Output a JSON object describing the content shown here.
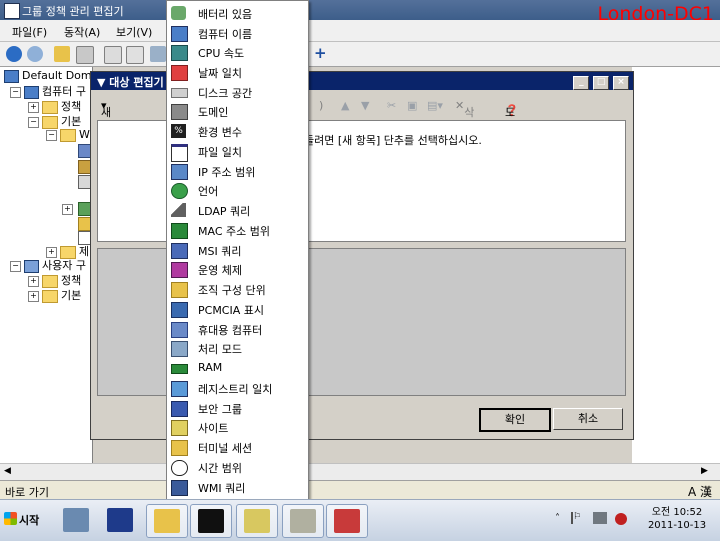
{
  "window": {
    "title": "그룹 정책 관리 편집기",
    "watermark": "London-DC1"
  },
  "menubar": {
    "items": [
      "파일(F)",
      "동작(A)",
      "보기(V)"
    ]
  },
  "tree": {
    "nodes": [
      {
        "label": "Default Dom"
      },
      {
        "label": "컴퓨터 구"
      },
      {
        "label": "정책"
      },
      {
        "label": "기본"
      },
      {
        "label": "W"
      },
      {
        "label": "제"
      },
      {
        "label": "사용자 구"
      },
      {
        "label": "정책"
      },
      {
        "label": "기본"
      }
    ]
  },
  "dialog": {
    "title": "대상 편집기",
    "new_item": "새 항목(N)",
    "delete": "삭제",
    "help": "도움말(H)",
    "hint_text": "들려면 [새 항목] 단추를 선택하십시오.",
    "ok": "확인",
    "cancel": "취소"
  },
  "menu": {
    "items": [
      {
        "label": "배터리 있음",
        "icon": "battery-icon"
      },
      {
        "label": "컴퓨터 이름",
        "icon": "computer-icon"
      },
      {
        "label": "CPU 속도",
        "icon": "cpu-icon"
      },
      {
        "label": "날짜 일치",
        "icon": "calendar-icon"
      },
      {
        "label": "디스크 공간",
        "icon": "disk-icon"
      },
      {
        "label": "도메인",
        "icon": "domain-icon"
      },
      {
        "label": "환경 변수",
        "icon": "variable-icon"
      },
      {
        "label": "파일 일치",
        "icon": "file-window-icon"
      },
      {
        "label": "IP 주소 범위",
        "icon": "network-icon"
      },
      {
        "label": "언어",
        "icon": "globe-icon"
      },
      {
        "label": "LDAP 쿼리",
        "icon": "ldap-icon"
      },
      {
        "label": "MAC 주소 범위",
        "icon": "nic-icon"
      },
      {
        "label": "MSI 쿼리",
        "icon": "msi-icon"
      },
      {
        "label": "운영 체제",
        "icon": "os-icon"
      },
      {
        "label": "조직 구성 단위",
        "icon": "ou-icon"
      },
      {
        "label": "PCMCIA 표시",
        "icon": "pcmcia-icon"
      },
      {
        "label": "휴대용 컴퓨터",
        "icon": "laptop-icon"
      },
      {
        "label": "처리 모드",
        "icon": "processing-icon"
      },
      {
        "label": "RAM",
        "icon": "ram-icon"
      },
      {
        "label": "레지스트리 일치",
        "icon": "registry-icon"
      },
      {
        "label": "보안 그룹",
        "icon": "security-group-icon"
      },
      {
        "label": "사이트",
        "icon": "site-icon"
      },
      {
        "label": "터미널 세션",
        "icon": "terminal-icon"
      },
      {
        "label": "시간 범위",
        "icon": "clock-icon"
      },
      {
        "label": "WMI 쿼리",
        "icon": "wmi-icon"
      }
    ]
  },
  "statusbar": {
    "text": "바로 가기",
    "ime": "A 漢"
  },
  "taskbar": {
    "start": "시작",
    "time": "오전 10:52",
    "date": "2011-10-13",
    "apps": [
      "server-manager-icon",
      "powershell-icon",
      "explorer-icon",
      "cmd-icon",
      "notepad-icon",
      "gp-editor-icon",
      "toolbox-icon"
    ]
  }
}
